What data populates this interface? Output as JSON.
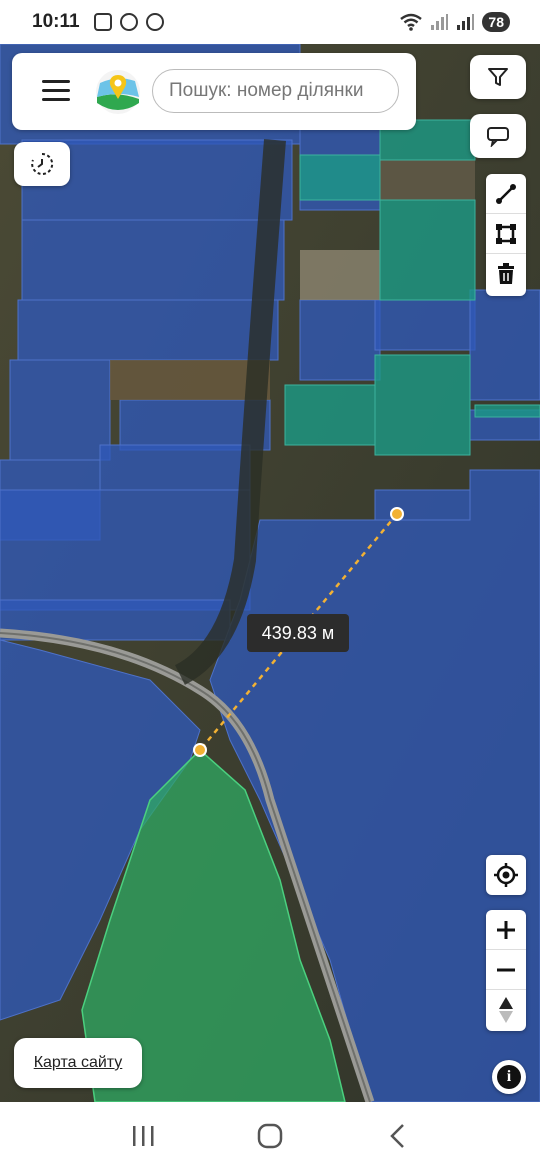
{
  "status": {
    "time": "10:11",
    "battery": "78"
  },
  "search": {
    "placeholder": "Пошук: номер ділянки"
  },
  "map": {
    "distance_label": "439.83 м"
  },
  "footer": {
    "sitemap_label": "Карта сайту"
  },
  "colors": {
    "parcel_blue": "#2f58b8",
    "parcel_teal": "#1c9a86",
    "selected_green": "#2faa63",
    "measure_line": "#f2b134"
  },
  "icons": {
    "menu": "hamburger-icon",
    "logo": "map-pin-logo-icon",
    "filter": "filter-icon",
    "chat": "chat-icon",
    "history": "history-icon",
    "measure": "ruler-line-icon",
    "polygon": "polygon-icon",
    "delete": "trash-icon",
    "locate": "locate-icon",
    "zoom_in": "plus-icon",
    "zoom_out": "minus-icon",
    "compass": "compass-icon",
    "info": "info-icon"
  }
}
